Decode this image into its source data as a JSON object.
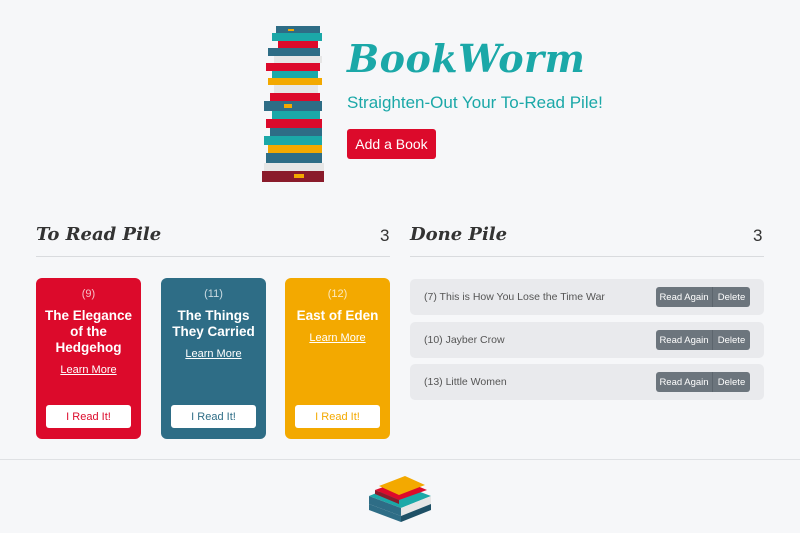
{
  "header": {
    "title": "BookWorm",
    "tagline": "Straighten-Out Your To-Read Pile!",
    "add_button": "Add a Book",
    "logo_icon": "book-stack-icon"
  },
  "to_read": {
    "title": "To Read Pile",
    "count": "3",
    "cards": [
      {
        "number": "(9)",
        "title": "The Elegance of the Hedgehog",
        "link": "Learn More",
        "button": "I Read It!",
        "color": "#dc0a2b"
      },
      {
        "number": "(11)",
        "title": "The Things They Carried",
        "link": "Learn More",
        "button": "I Read It!",
        "color": "#2e6d86"
      },
      {
        "number": "(12)",
        "title": "East of Eden",
        "link": "Learn More",
        "button": "I Read It!",
        "color": "#f3a900"
      }
    ]
  },
  "done": {
    "title": "Done Pile",
    "count": "3",
    "items": [
      {
        "text": "(7) This is How You Lose the Time War",
        "read_again": "Read Again",
        "delete": "Delete"
      },
      {
        "text": "(10) Jayber Crow",
        "read_again": "Read Again",
        "delete": "Delete"
      },
      {
        "text": "(13) Little Women",
        "read_again": "Read Again",
        "delete": "Delete"
      }
    ]
  },
  "footer": {
    "logo_icon": "books-icon"
  },
  "colors": {
    "teal": "#1ba8a8",
    "red": "#dc0a2b",
    "blue": "#2e6d86",
    "yellow": "#f3a900",
    "gray_button": "#6c757d"
  }
}
